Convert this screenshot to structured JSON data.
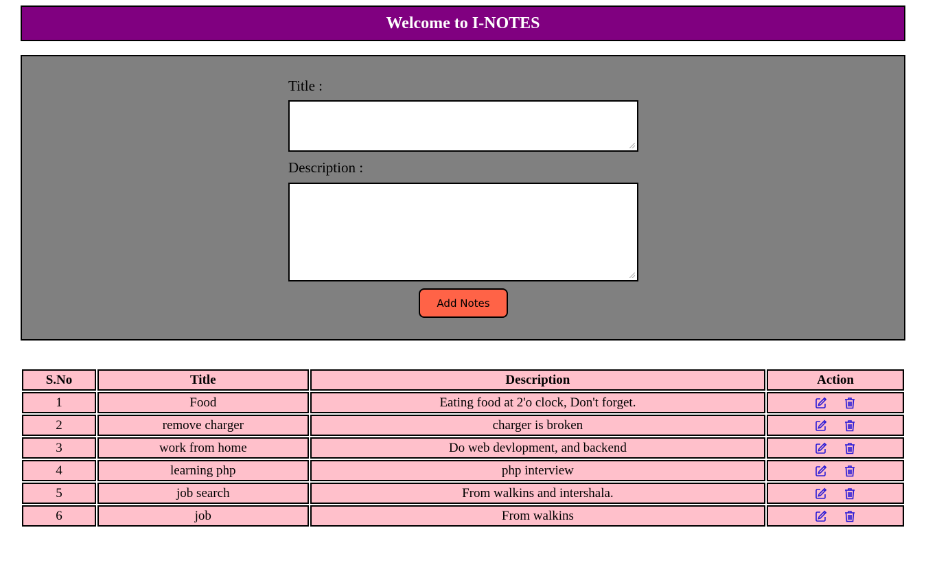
{
  "header": {
    "title": "Welcome to I-NOTES"
  },
  "form": {
    "title_label": "Title :",
    "title_value": "",
    "description_label": "Description :",
    "description_value": "",
    "add_button_label": "Add Notes"
  },
  "table": {
    "headers": [
      "S.No",
      "Title",
      "Description",
      "Action"
    ],
    "rows": [
      {
        "sno": "1",
        "title": "Food",
        "description": "Eating food at 2'o clock, Don't forget."
      },
      {
        "sno": "2",
        "title": "remove charger",
        "description": "charger is broken"
      },
      {
        "sno": "3",
        "title": "work from home",
        "description": "Do web devlopment, and backend"
      },
      {
        "sno": "4",
        "title": "learning php",
        "description": "php interview"
      },
      {
        "sno": "5",
        "title": "job search",
        "description": "From walkins and intershala."
      },
      {
        "sno": "6",
        "title": "job",
        "description": "From walkins"
      }
    ],
    "row_icons": [
      "edit-icon",
      "trash-icon"
    ]
  },
  "colors": {
    "header_bg": "#800080",
    "panel_bg": "#808080",
    "button_bg": "#ff6347",
    "table_cell_bg": "#ffc0cb",
    "icon_color": "#0000ee"
  }
}
